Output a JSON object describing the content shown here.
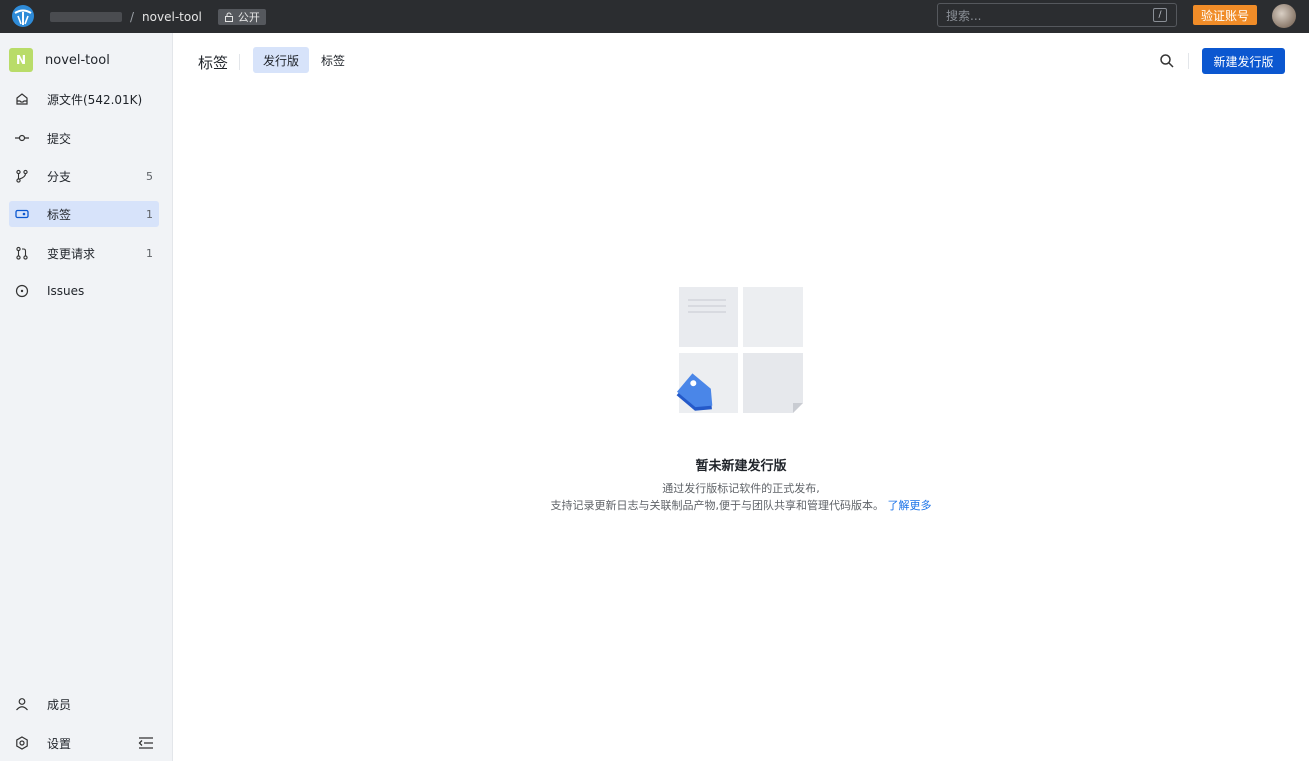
{
  "topbar": {
    "project_name": "novel-tool",
    "separator": "/",
    "visibility": "公开",
    "search_placeholder": "搜索...",
    "search_shortcut": "/",
    "verify_button": "验证账号"
  },
  "sidebar": {
    "project_initial": "N",
    "project_name": "novel-tool",
    "items": [
      {
        "label": "源文件(542.01K)",
        "icon": "code-repo-icon",
        "count": ""
      },
      {
        "label": "提交",
        "icon": "commit-icon",
        "count": ""
      },
      {
        "label": "分支",
        "icon": "branch-icon",
        "count": "5"
      },
      {
        "label": "标签",
        "icon": "tag-icon",
        "count": "1"
      },
      {
        "label": "变更请求",
        "icon": "pull-request-icon",
        "count": "1"
      },
      {
        "label": "Issues",
        "icon": "issue-icon",
        "count": ""
      }
    ],
    "bottom_items": [
      {
        "label": "成员",
        "icon": "user-icon"
      },
      {
        "label": "设置",
        "icon": "settings-icon"
      }
    ]
  },
  "main": {
    "title": "标签",
    "tabs": [
      {
        "label": "发行版",
        "active": true
      },
      {
        "label": "标签",
        "active": false
      }
    ],
    "new_release_button": "新建发行版",
    "empty": {
      "title": "暂未新建发行版",
      "line1": "通过发行版标记软件的正式发布,",
      "line2": "支持记录更新日志与关联制品产物,便于与团队共享和管理代码版本。",
      "learn_more": "了解更多"
    }
  },
  "colors": {
    "accent": "#0b57d0",
    "active_bg": "#d7e3fa",
    "verify": "#f08c28",
    "topbar": "#2b2d30"
  }
}
